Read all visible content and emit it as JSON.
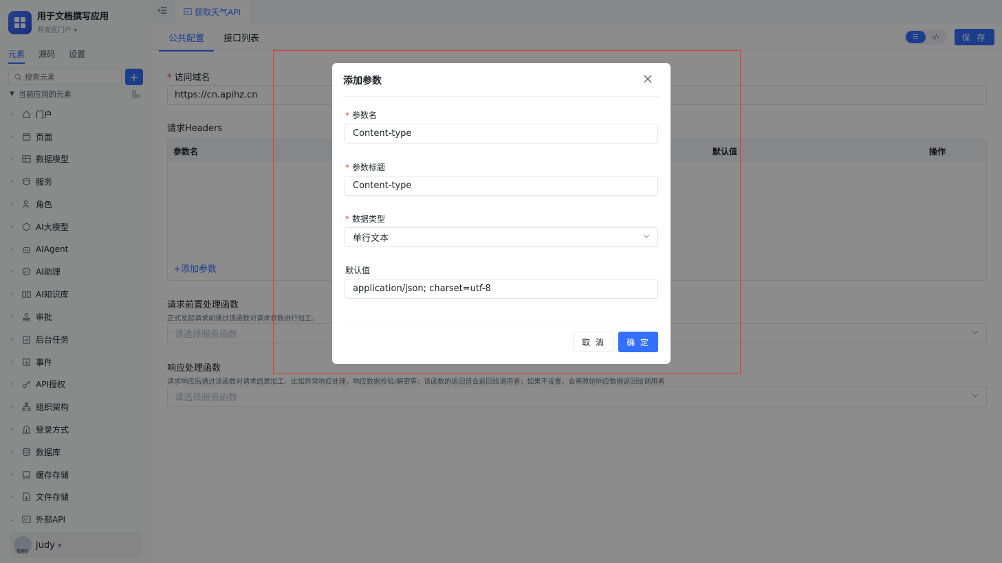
{
  "app": {
    "title": "用于文档撰写应用",
    "portal": "开发区门户"
  },
  "sidebar": {
    "tabs": [
      "元素",
      "源码",
      "设置"
    ],
    "search_placeholder": "搜索元素",
    "tree_title": "当前应用的元素",
    "items": [
      {
        "label": "门户",
        "icon": "home-icon"
      },
      {
        "label": "页面",
        "icon": "page-icon"
      },
      {
        "label": "数据模型",
        "icon": "table-icon"
      },
      {
        "label": "服务",
        "icon": "service-icon"
      },
      {
        "label": "角色",
        "icon": "role-icon"
      },
      {
        "label": "AI大模型",
        "icon": "ai-model-icon"
      },
      {
        "label": "AIAgent",
        "icon": "robot-icon"
      },
      {
        "label": "AI助理",
        "icon": "ai-assistant-icon"
      },
      {
        "label": "AI知识库",
        "icon": "book-icon"
      },
      {
        "label": "审批",
        "icon": "stamp-icon"
      },
      {
        "label": "后台任务",
        "icon": "task-icon"
      },
      {
        "label": "事件",
        "icon": "event-icon"
      },
      {
        "label": "API授权",
        "icon": "key-icon"
      },
      {
        "label": "组织架构",
        "icon": "org-icon"
      },
      {
        "label": "登录方式",
        "icon": "login-icon"
      },
      {
        "label": "数据库",
        "icon": "database-icon"
      },
      {
        "label": "缓存存储",
        "icon": "cache-icon"
      },
      {
        "label": "文件存储",
        "icon": "file-icon"
      },
      {
        "label": "外部API",
        "icon": "api-icon"
      }
    ],
    "user": {
      "name": "judy",
      "avatar_text": "管理员"
    }
  },
  "top": {
    "page_tab": "获取天气API",
    "sub_tabs": [
      "公共配置",
      "接口列表"
    ],
    "save_label": "保 存"
  },
  "form": {
    "domain_label": "访问域名",
    "domain_value": "https://cn.apihz.cn",
    "headers_label": "请求Headers",
    "headers_columns": [
      "参数名",
      "默认值",
      "操作"
    ],
    "add_param": "+添加参数",
    "pre_label": "请求前置处理函数",
    "pre_help": "正式发起请求前通过该函数对请求参数进行加工。",
    "pre_placeholder": "请选择服务函数",
    "resp_label": "响应处理函数",
    "resp_help": "请求响应后通过该函数对请求结果加工，比如异常响应处理，响应数据校验/解密等；该函数的返回值会返回给调用者；如果不设置，会将原始响应数据返回给调用者",
    "resp_placeholder": "请选择服务函数"
  },
  "modal": {
    "title": "添加参数",
    "fields": {
      "name_label": "参数名",
      "name_value": "Content-type",
      "title_label": "参数标题",
      "title_value": "Content-type",
      "type_label": "数据类型",
      "type_value": "单行文本",
      "default_label": "默认值",
      "default_value": "application/json; charset=utf-8"
    },
    "cancel": "取 消",
    "ok": "确 定"
  },
  "colors": {
    "accent": "#3370ff",
    "required": "#f53f3f",
    "highlight": "#e53935"
  }
}
